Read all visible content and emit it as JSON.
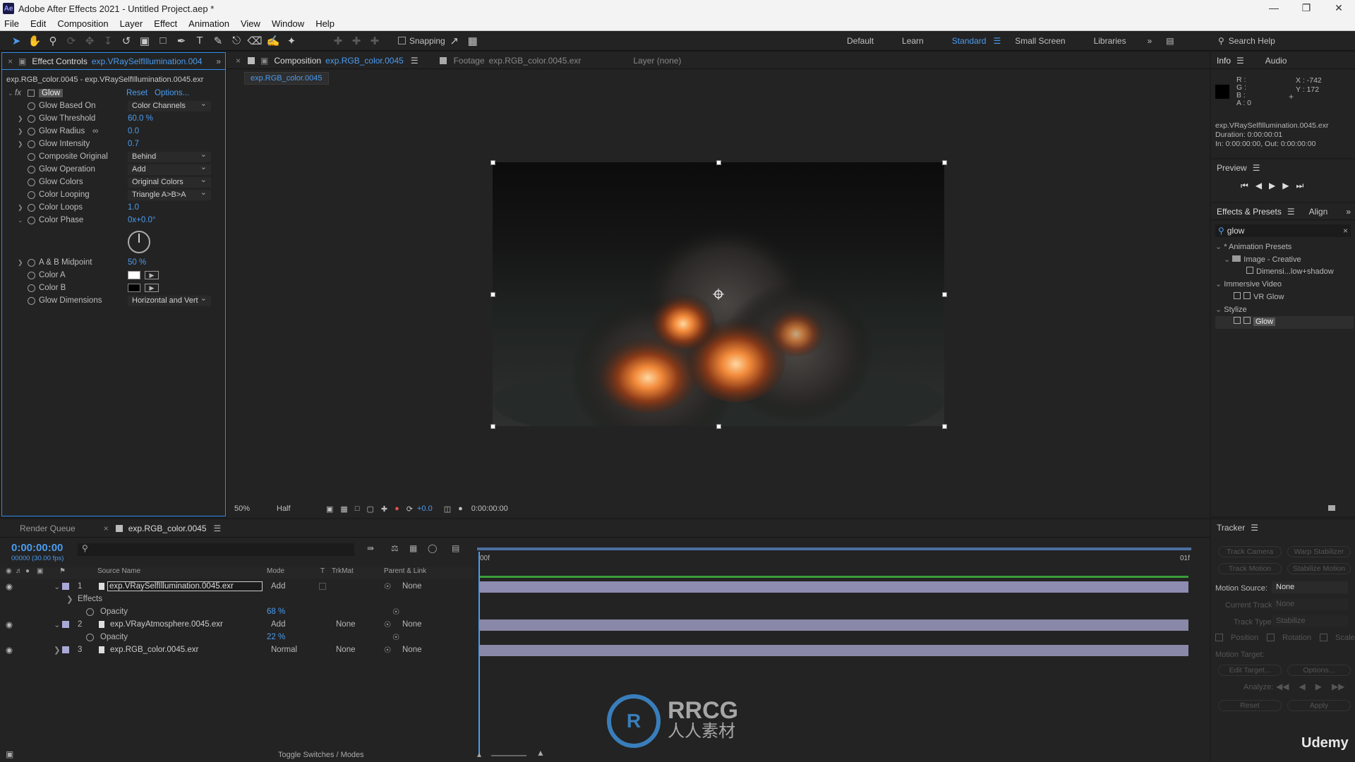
{
  "app": {
    "title": "Adobe After Effects 2021 - Untitled Project.aep *",
    "logo": "Ae"
  },
  "menu": [
    "File",
    "Edit",
    "Composition",
    "Layer",
    "Effect",
    "Animation",
    "View",
    "Window",
    "Help"
  ],
  "toolbar": {
    "snapping_label": "Snapping",
    "workspaces": [
      "Default",
      "Learn",
      "Standard",
      "Small Screen",
      "Libraries"
    ],
    "active_workspace": "Standard",
    "search_placeholder": "Search Help"
  },
  "effect_controls": {
    "tab_label": "Effect Controls",
    "tab_layer": "exp.VRaySelfIllumination.004",
    "breadcrumb": "exp.RGB_color.0045 - exp.VRaySelfIllumination.0045.exr",
    "effect_name": "Glow",
    "reset_label": "Reset",
    "options_label": "Options...",
    "properties": [
      {
        "label": "Glow Based On",
        "value": "Color Channels"
      },
      {
        "label": "Glow Threshold",
        "value": "60.0 %"
      },
      {
        "label": "Glow Radius",
        "value": "0.0"
      },
      {
        "label": "Glow Intensity",
        "value": "0.7"
      },
      {
        "label": "Composite Original",
        "value": "Behind"
      },
      {
        "label": "Glow Operation",
        "value": "Add"
      },
      {
        "label": "Glow Colors",
        "value": "Original Colors"
      },
      {
        "label": "Color Looping",
        "value": "Triangle A>B>A"
      },
      {
        "label": "Color Loops",
        "value": "1.0"
      },
      {
        "label": "Color Phase",
        "value": "0x+0.0°"
      },
      {
        "label": "A & B Midpoint",
        "value": "50 %"
      },
      {
        "label": "Color A",
        "value": ""
      },
      {
        "label": "Color B",
        "value": ""
      },
      {
        "label": "Glow Dimensions",
        "value": "Horizontal and Vert"
      }
    ]
  },
  "composition": {
    "tab_label": "Composition",
    "tab_comp": "exp.RGB_color.0045",
    "footage_label": "Footage",
    "footage_name": "exp.RGB_color.0045.exr",
    "layer_label": "Layer (none)",
    "sub_tab": "exp.RGB_color.0045",
    "zoom": "50%",
    "resolution": "Half",
    "exposure": "+0.0",
    "timecode": "0:00:00:00"
  },
  "timeline": {
    "render_queue_label": "Render Queue",
    "comp_tab": "exp.RGB_color.0045",
    "current_time": "0:00:00:00",
    "fps_info": "00000 (30.00 fps)",
    "columns": {
      "source": "Source Name",
      "mode": "Mode",
      "t": "T",
      "trkmat": "TrkMat",
      "parent": "Parent & Link"
    },
    "ruler_start": "00f",
    "ruler_end": "01f",
    "layers": [
      {
        "num": "1",
        "name": "exp.VRaySelfIllumination.0045.exr",
        "mode": "Add",
        "trkmat": "",
        "parent": "None"
      },
      {
        "num": "2",
        "name": "exp.VRayAtmosphere.0045.exr",
        "mode": "Add",
        "trkmat": "None",
        "parent": "None"
      },
      {
        "num": "3",
        "name": "exp.RGB_color.0045.exr",
        "mode": "Normal",
        "trkmat": "None",
        "parent": "None"
      }
    ],
    "effects_label": "Effects",
    "opacity_label": "Opacity",
    "opacity_1": "68 %",
    "opacity_2": "22 %",
    "toggle_label": "Toggle Switches / Modes"
  },
  "info": {
    "tab_info": "Info",
    "tab_audio": "Audio",
    "r": "R :",
    "g": "G :",
    "b": "B :",
    "a": "A :  0",
    "x": "X : -742",
    "y": "Y :  172",
    "file": "exp.VRaySelfIllumination.0045.exr",
    "duration": "Duration: 0:00:00:01",
    "inout": "In: 0:00:00:00, Out: 0:00:00:00"
  },
  "preview": {
    "label": "Preview"
  },
  "effects_presets": {
    "tab": "Effects & Presets",
    "align_tab": "Align",
    "search_value": "glow",
    "tree": [
      {
        "label": "* Animation Presets",
        "level": 0
      },
      {
        "label": "Image - Creative",
        "level": 1
      },
      {
        "label": "Dimensi...low+shadow",
        "level": 2
      },
      {
        "label": "Immersive Video",
        "level": 0
      },
      {
        "label": "VR Glow",
        "level": 1
      },
      {
        "label": "Stylize",
        "level": 0
      },
      {
        "label": "Glow",
        "level": 1
      }
    ]
  },
  "tracker": {
    "label": "Tracker",
    "track_camera": "Track Camera",
    "warp_stabilizer": "Warp Stabilizer",
    "track_motion": "Track Motion",
    "stabilize_motion": "Stabilize Motion",
    "motion_source_label": "Motion Source:",
    "motion_source_value": "None",
    "current_track_label": "Current Track:",
    "current_track_value": "None",
    "track_type_label": "Track Type:",
    "track_type_value": "Stabilize",
    "position": "Position",
    "rotation": "Rotation",
    "scale": "Scale",
    "motion_target": "Motion Target:",
    "edit_target": "Edit Target...",
    "options": "Options...",
    "analyze": "Analyze:",
    "reset": "Reset",
    "apply": "Apply"
  },
  "watermark": {
    "brand": "RRCG",
    "sub": "人人素材",
    "udemy": "Udemy"
  }
}
